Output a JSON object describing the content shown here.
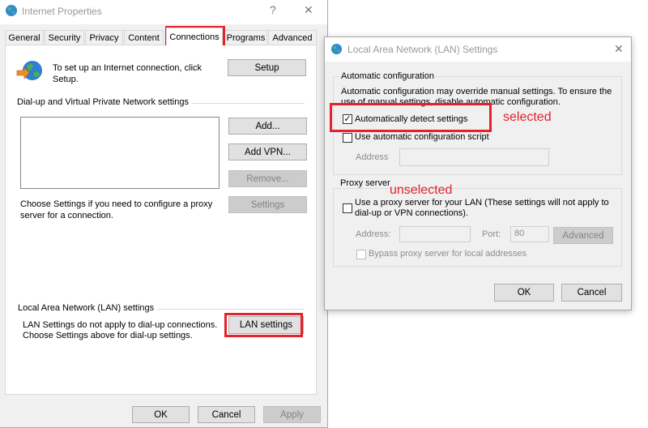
{
  "internet_properties": {
    "title": "Internet Properties",
    "help_glyph": "?",
    "close_glyph": "✕",
    "tabs": [
      "General",
      "Security",
      "Privacy",
      "Content",
      "Connections",
      "Programs",
      "Advanced"
    ],
    "active_tab": "Connections",
    "setup_text": "To set up an Internet connection, click Setup.",
    "setup_button": "Setup",
    "dialup_group_title": "Dial-up and Virtual Private Network settings",
    "add_button": "Add...",
    "add_vpn_button": "Add VPN...",
    "remove_button": "Remove...",
    "proxy_text": "Choose Settings if you need to configure a proxy server for a connection.",
    "settings_button": "Settings",
    "lan_group_title": "Local Area Network (LAN) settings",
    "lan_text_line1": "LAN Settings do not apply to dial-up connections.",
    "lan_text_line2": "Choose Settings above for dial-up settings.",
    "lan_settings_button": "LAN settings",
    "ok_button": "OK",
    "cancel_button": "Cancel",
    "apply_button": "Apply"
  },
  "lan_dialog": {
    "title": "Local Area Network (LAN) Settings",
    "close_glyph": "✕",
    "auto_config_title": "Automatic configuration",
    "auto_config_desc_line1": "Automatic configuration may override manual settings.  To ensure the",
    "auto_config_desc_line2": "use of manual settings, disable automatic configuration.",
    "auto_detect_label": "Automatically detect settings",
    "auto_detect_checked": true,
    "auto_script_label": "Use automatic configuration script",
    "auto_script_checked": false,
    "address_label": "Address",
    "proxy_title": "Proxy server",
    "proxy_label_line1": "Use a proxy server for your LAN (These settings will not apply to",
    "proxy_label_line2": "dial-up or VPN connections).",
    "proxy_checked": false,
    "proxy_address_label": "Address:",
    "proxy_port_label": "Port:",
    "proxy_port_value": "80",
    "advanced_button": "Advanced",
    "bypass_label": "Bypass proxy server for local addresses",
    "ok_button": "OK",
    "cancel_button": "Cancel"
  },
  "annotations": {
    "selected": "selected",
    "unselected": "unselected"
  },
  "colors": {
    "highlight": "#e3222c"
  }
}
